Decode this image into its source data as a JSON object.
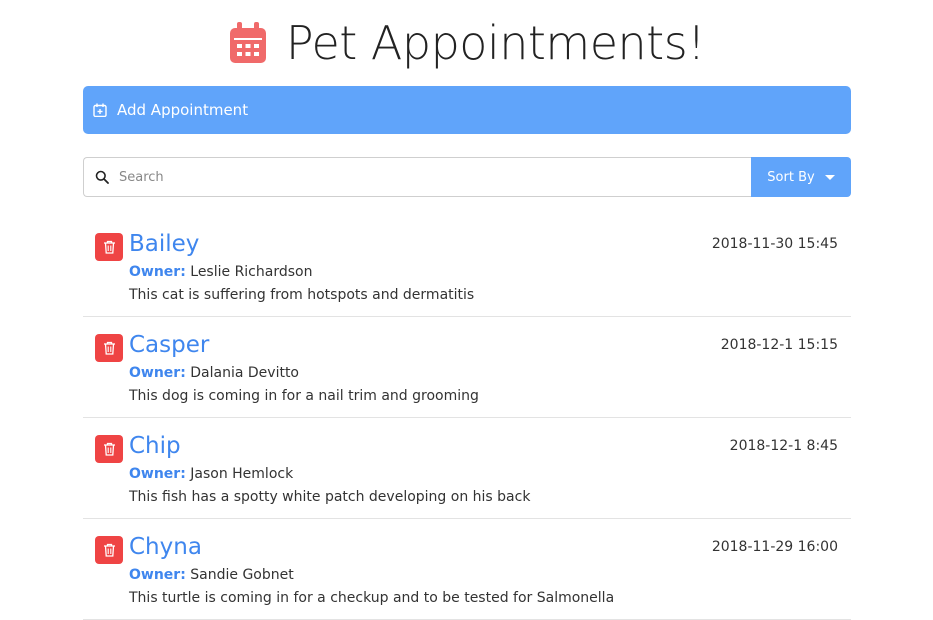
{
  "header": {
    "title": "Pet Appointments!",
    "icon": "calendar-icon",
    "icon_color": "#f06a6a"
  },
  "add_bar": {
    "label": "Add Appointment",
    "color": "#60a4fa"
  },
  "search": {
    "placeholder": "Search",
    "value": ""
  },
  "sort": {
    "label": "Sort By"
  },
  "appointments": [
    {
      "pet": "Bailey",
      "date": "2018-11-30 15:45",
      "owner_label": "Owner:",
      "owner": "Leslie Richardson",
      "notes": "This cat is suffering from hotspots and dermatitis"
    },
    {
      "pet": "Casper",
      "date": "2018-12-1 15:15",
      "owner_label": "Owner:",
      "owner": "Dalania Devitto",
      "notes": "This dog is coming in for a nail trim and grooming"
    },
    {
      "pet": "Chip",
      "date": "2018-12-1 8:45",
      "owner_label": "Owner:",
      "owner": "Jason Hemlock",
      "notes": "This fish has a spotty white patch developing on his back"
    },
    {
      "pet": "Chyna",
      "date": "2018-11-29 16:00",
      "owner_label": "Owner:",
      "owner": "Sandie Gobnet",
      "notes": "This turtle is coming in for a checkup and to be tested for Salmonella"
    }
  ]
}
